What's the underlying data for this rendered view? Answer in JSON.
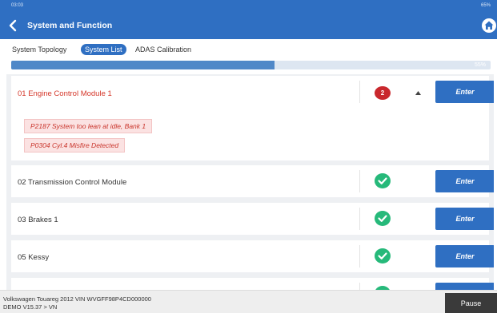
{
  "status": {
    "time": "03:03",
    "system": "65%"
  },
  "header": {
    "title": "System and Function",
    "back_icon": "chevron-left-icon",
    "home_icon": "home-icon"
  },
  "tabs": [
    {
      "label": "System Topology",
      "selected": false
    },
    {
      "label": "System List",
      "selected": true
    },
    {
      "label": "ADAS Calibration",
      "selected": false
    }
  ],
  "progress": {
    "percent": 55,
    "label": "55%"
  },
  "systems": [
    {
      "name": "01 Engine Control Module 1",
      "status": "fault",
      "fault_count": "2",
      "expanded": true,
      "dtcs": [
        "P2187 System too lean at idle, Bank 1",
        "P0304 Cyl.4 Misfire Detected"
      ],
      "button": "Enter"
    },
    {
      "name": "02 Transmission Control Module",
      "status": "ok",
      "button": "Enter"
    },
    {
      "name": "03 Brakes 1",
      "status": "ok",
      "button": "Enter"
    },
    {
      "name": "05 Kessy",
      "status": "ok",
      "button": "Enter"
    }
  ],
  "footer": {
    "vehicle": "Volkswagen  Touareg  2012  VIN  WVGFF98P4CD000000",
    "version": "DEMO V15.37 > VN",
    "pause_label": "Pause"
  },
  "colors": {
    "primary": "#2f6fc2",
    "fault": "#c9282d",
    "ok": "#26b97a",
    "fault_text": "#d5372a"
  }
}
